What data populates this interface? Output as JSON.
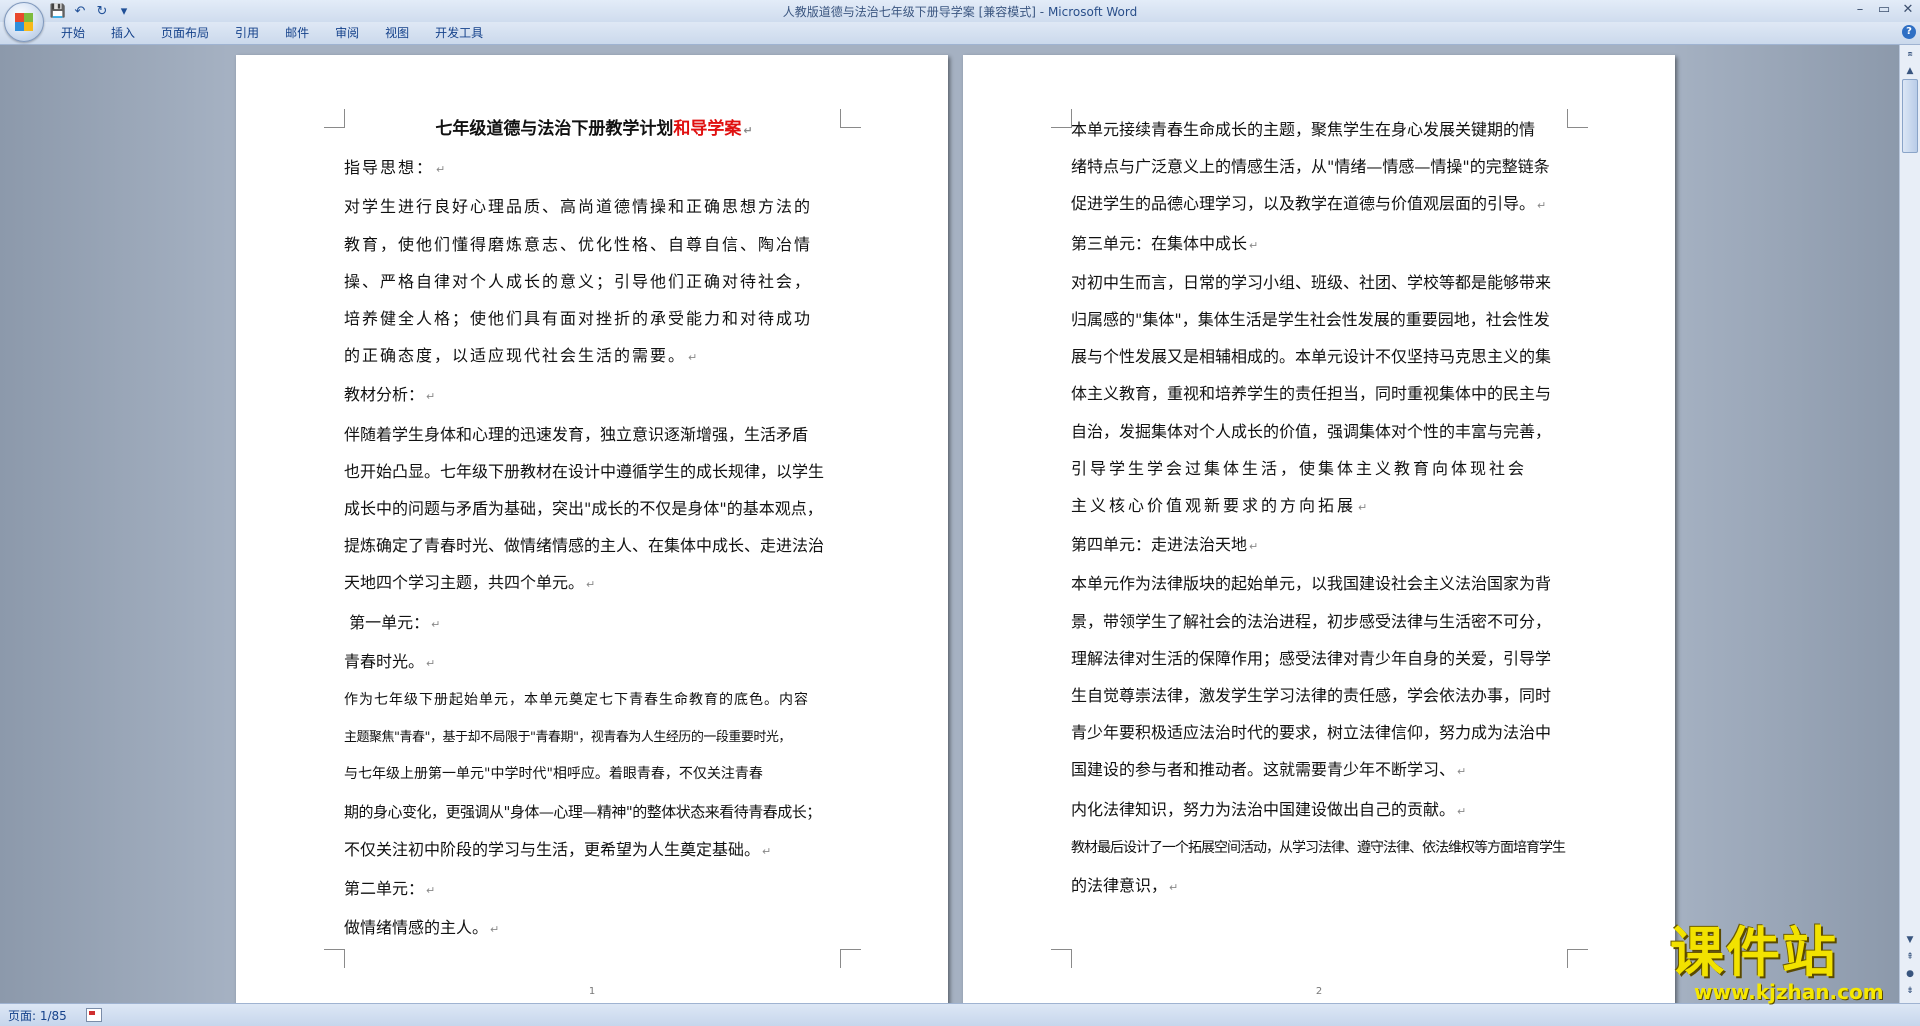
{
  "window": {
    "title": "人教版道德与法治七年级下册导学案 [兼容模式]",
    "title_sep": " - ",
    "app_name": "Microsoft Word",
    "minimize": "–",
    "restore": "▭",
    "close": "✕"
  },
  "quick_access": {
    "save": "💾",
    "undo": "↶",
    "redo": "↻",
    "customize": "▾"
  },
  "ribbon": {
    "tabs": [
      "开始",
      "插入",
      "页面布局",
      "引用",
      "邮件",
      "审阅",
      "视图",
      "开发工具"
    ],
    "help": "?"
  },
  "document": {
    "paragraph_mark": "↵",
    "page1": {
      "title_main": "七年级道德与法治下册教学计划",
      "title_red": "和导学案",
      "lines": [
        "指导思想：",
        "对学生进行良好心理品质、高尚道德情操和正确思想方法的",
        "教育，使他们懂得磨炼意志、优化性格、自尊自信、陶冶情",
        "操、严格自律对个人成长的意义；引导他们正确对待社会，",
        "培养健全人格；使他们具有面对挫折的承受能力和对待成功",
        "的正确态度，以适应现代社会生活的需要。",
        "教材分析：",
        "伴随着学生身体和心理的迅速发育，独立意识逐渐增强，生活矛盾",
        "也开始凸显。七年级下册教材在设计中遵循学生的成长规律，以学生",
        "成长中的问题与矛盾为基础，突出\"成长的不仅是身体\"的基本观点，",
        "提炼确定了青春时光、做情绪情感的主人、在集体中成长、走进法治",
        "天地四个学习主题，共四个单元。",
        " 第一单元：",
        "青春时光。",
        "作为七年级下册起始单元，本单元奠定七下青春生命教育的底色。内容",
        "主题聚焦\"青春\"，基于却不局限于\"青春期\"，视青春为人生经历的一段重要时光，",
        "与七年级上册第一单元\"中学时代\"相呼应。着眼青春，不仅关注青春",
        "期的身心变化，更强调从\"身体—心理—精神\"的整体状态来看待青春成长；",
        "不仅关注初中阶段的学习与生活，更希望为人生奠定基础。",
        "第二单元：",
        "做情绪情感的主人。"
      ],
      "page_number": "1"
    },
    "page2": {
      "lines": [
        "本单元接续青春生命成长的主题，聚焦学生在身心发展关键期的情",
        "绪特点与广泛意义上的情感生活，从\"情绪—情感—情操\"的完整链条",
        "促进学生的品德心理学习，以及教学在道德与价值观层面的引导。",
        "第三单元：在集体中成长",
        "对初中生而言，日常的学习小组、班级、社团、学校等都是能够带来",
        "归属感的\"集体\"，集体生活是学生社会性发展的重要园地，社会性发",
        "展与个性发展又是相辅相成的。本单元设计不仅坚持马克思主义的集",
        "体主义教育，重视和培养学生的责任担当，同时重视集体中的民主与",
        "自治，发掘集体对个人成长的价值，强调集体对个性的丰富与完善，",
        "引导学生学会过集体生活，使集体主义教育向体现社会",
        "主义核心价值观新要求的方向拓展",
        "第四单元：走进法治天地",
        "本单元作为法律版块的起始单元，以我国建设社会主义法治国家为背",
        "景，带领学生了解社会的法治进程，初步感受法律与生活密不可分，",
        "理解法律对生活的保障作用；感受法律对青少年自身的关爱，引导学",
        "生自觉尊崇法律，激发学生学习法律的责任感，学会依法办事，同时",
        "青少年要积极适应法治时代的要求，树立法律信仰，努力成为法治中",
        "国建设的参与者和推动者。这就需要青少年不断学习、",
        "内化法律知识，努力为法治中国建设做出自己的贡献。",
        "教材最后设计了一个拓展空间活动，从学习法律、遵守法律、依法维权等方面培育学生",
        "的法律意识，"
      ],
      "page_number": "2"
    }
  },
  "scrollbar": {
    "up": "▲",
    "down": "▼",
    "prev_page": "⇞",
    "browse": "●",
    "next_page": "⇟"
  },
  "status": {
    "page_info": "页面: 1/85"
  },
  "watermark": {
    "text": "课件站",
    "url": "www.kjzhan.com"
  },
  "colors": {
    "accent_red": "#e01010",
    "ribbon_text": "#15428b",
    "watermark_yellow": "#f2e200"
  }
}
